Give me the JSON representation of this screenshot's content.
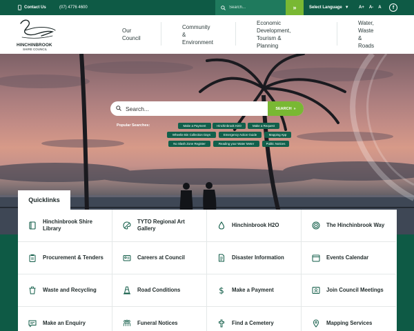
{
  "topbar": {
    "contact_label": "Contact Us",
    "phone": "(07) 4776 4600",
    "search_placeholder": "Search...",
    "search_button": "»",
    "language_label": "Select Language",
    "language_arrow": "▼",
    "font_sizes": [
      "A+",
      "A-",
      "A"
    ],
    "facebook": "f"
  },
  "logo": {
    "name": "HINCHINBROOK",
    "sub": "SHIRE COUNCIL"
  },
  "nav": [
    {
      "line1": "Our",
      "line2": "Council"
    },
    {
      "line1": "Community &",
      "line2": "Environment"
    },
    {
      "line1": "Economic Development,",
      "line2": "Tourism & Planning"
    },
    {
      "line1": "Water, Waste &",
      "line2": "Roads"
    }
  ],
  "hero": {
    "search_placeholder": "Search...",
    "search_button": "SEARCH",
    "search_button_arrow": "»",
    "popular_label": "Popular Searches:",
    "popular": [
      "Make a Payment",
      "Hinchinbrook H2O",
      "Make a Request",
      "Wheelie Bin Collection Days",
      "Emergency Action Guide",
      "Mapping App",
      "No Slash Zone Register",
      "Reading your Water Meter",
      "Public Notices"
    ]
  },
  "quicklinks": {
    "title": "Quicklinks",
    "items": [
      {
        "label": "Hinchinbrook Shire Library",
        "icon": "book-icon"
      },
      {
        "label": "TYTO Regional Art Gallery",
        "icon": "palette-icon"
      },
      {
        "label": "Hinchinbrook H2O",
        "icon": "water-drop-icon"
      },
      {
        "label": "The Hinchinbrook Way",
        "icon": "target-icon"
      },
      {
        "label": "Procurement & Tenders",
        "icon": "clipboard-icon"
      },
      {
        "label": "Careers at Council",
        "icon": "id-card-icon"
      },
      {
        "label": "Disaster Information",
        "icon": "document-icon"
      },
      {
        "label": "Events Calendar",
        "icon": "calendar-icon"
      },
      {
        "label": "Waste and Recycling",
        "icon": "bin-icon"
      },
      {
        "label": "Road Conditions",
        "icon": "traffic-cone-icon"
      },
      {
        "label": "Make a Payment",
        "icon": "dollar-icon"
      },
      {
        "label": "Join Council Meetings",
        "icon": "meeting-icon"
      },
      {
        "label": "Make an Enquiry",
        "icon": "chat-icon"
      },
      {
        "label": "Funeral Notices",
        "icon": "people-icon"
      },
      {
        "label": "Find a Cemetery",
        "icon": "cross-icon"
      },
      {
        "label": "Mapping Services",
        "icon": "map-pin-icon"
      }
    ]
  },
  "colors": {
    "primary": "#0e5a45",
    "accent": "#79b833",
    "pill": "#11604b"
  }
}
